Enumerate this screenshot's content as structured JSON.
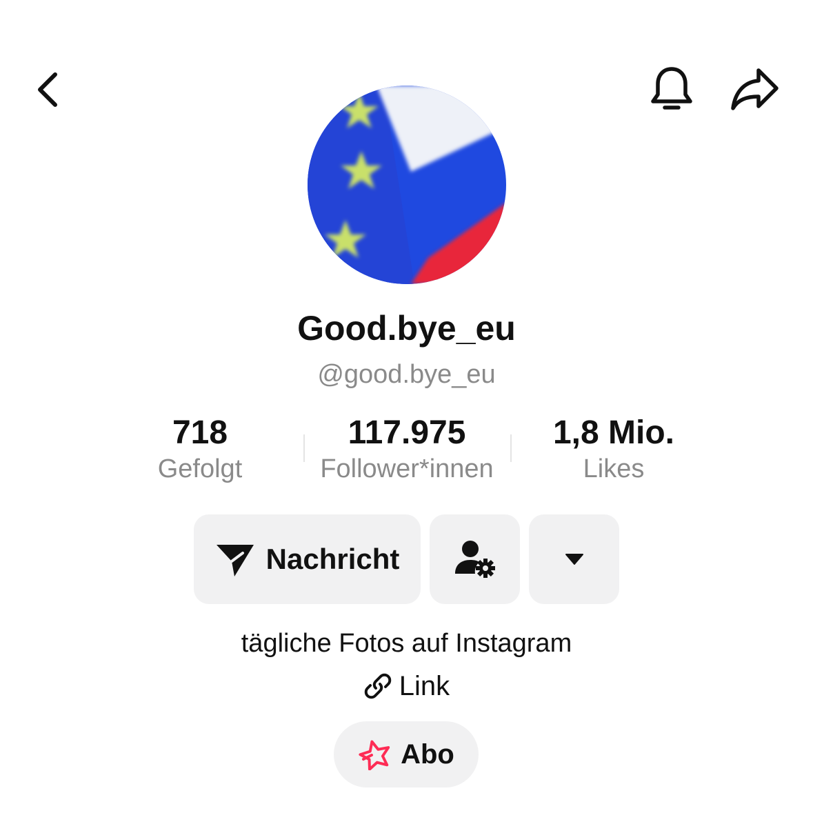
{
  "header": {
    "back_icon": "chevron-left-icon",
    "bell_icon": "bell-icon",
    "share_icon": "share-arrow-icon"
  },
  "profile": {
    "display_name": "Good.bye_eu",
    "username": "@good.bye_eu",
    "bio": "tägliche Fotos auf Instagram",
    "link_label": "Link"
  },
  "stats": [
    {
      "value": "718",
      "label": "Gefolgt"
    },
    {
      "value": "117.975",
      "label": "Follower*innen"
    },
    {
      "value": "1,8 Mio.",
      "label": "Likes"
    }
  ],
  "actions": {
    "message_label": "Nachricht",
    "message_icon": "paper-plane-icon",
    "profile_settings_icon": "person-gear-icon",
    "more_icon": "caret-down-icon"
  },
  "subscription": {
    "label": "Abo",
    "icon": "star-icon",
    "icon_color": "#fe2c55"
  },
  "colors": {
    "text_primary": "#111111",
    "text_secondary": "#8a8a8a",
    "button_bg": "#f1f1f2"
  }
}
